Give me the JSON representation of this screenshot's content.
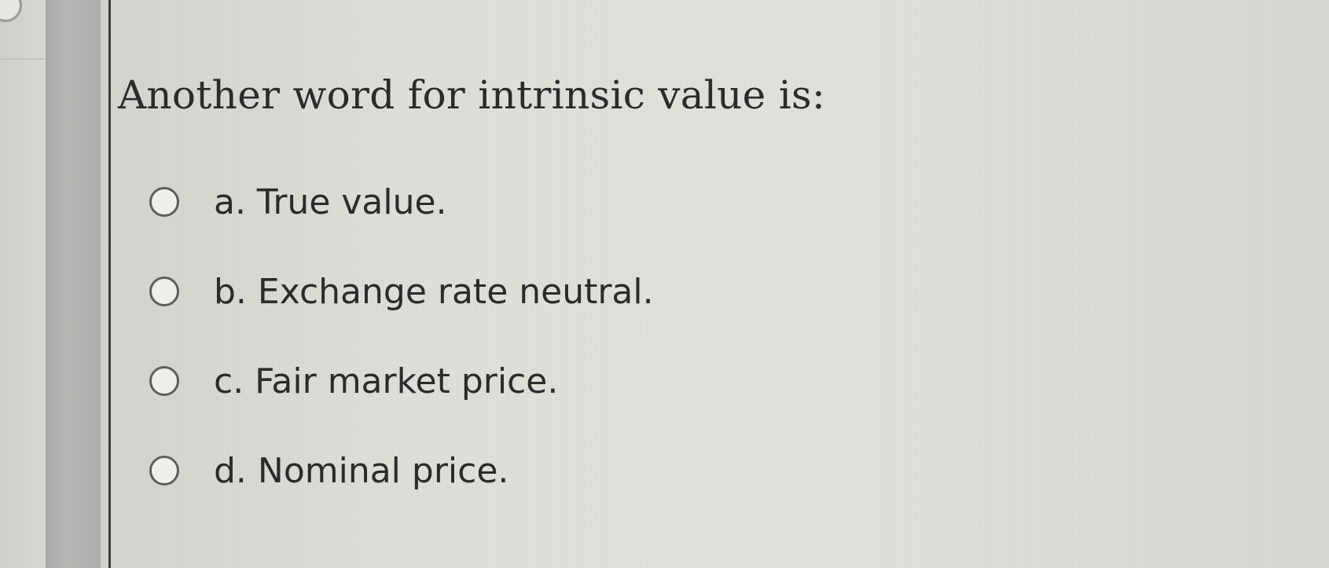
{
  "question": {
    "text": "Another word for intrinsic value is:"
  },
  "options": [
    {
      "label": "a. True value.",
      "selected": false
    },
    {
      "label": "b. Exchange rate neutral.",
      "selected": false
    },
    {
      "label": "c. Fair market price.",
      "selected": false
    },
    {
      "label": "d. Nominal price.",
      "selected": false
    }
  ]
}
